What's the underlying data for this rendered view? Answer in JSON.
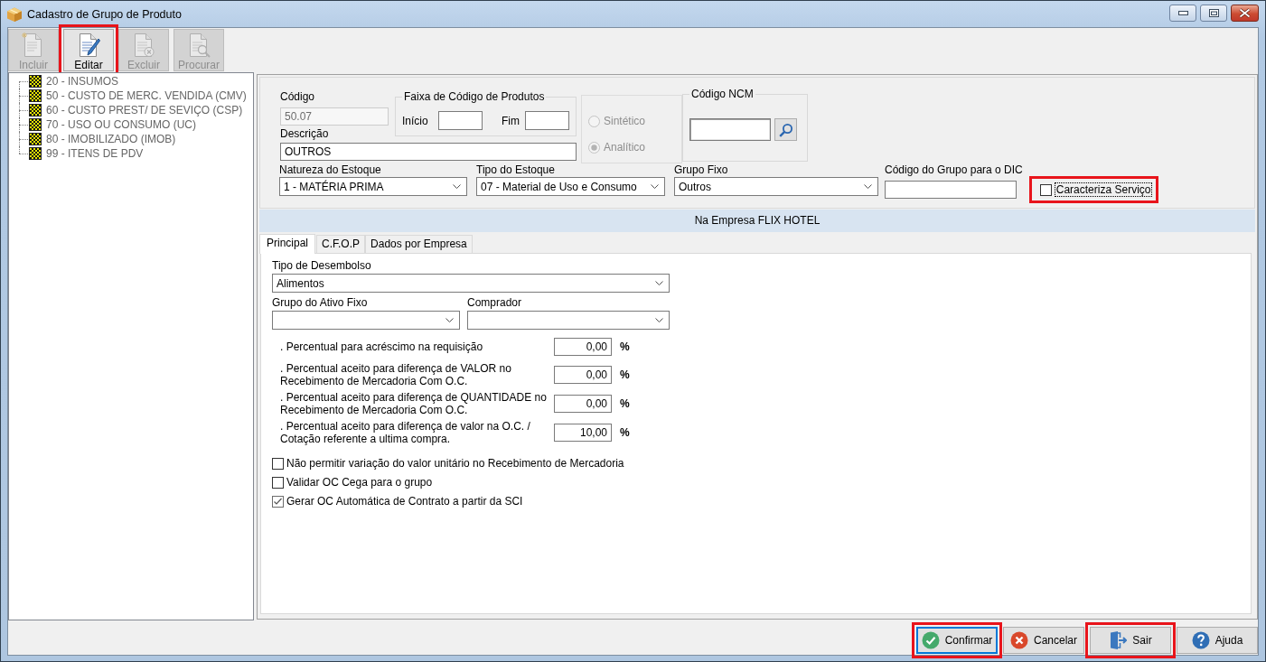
{
  "window": {
    "title": "Cadastro de Grupo de Produto"
  },
  "toolbar": [
    {
      "label": "Incluir",
      "kind": "new",
      "disabled": true,
      "highlighted": false
    },
    {
      "label": "Editar",
      "kind": "edit",
      "disabled": false,
      "highlighted": true
    },
    {
      "label": "Excluir",
      "kind": "delete",
      "disabled": true,
      "highlighted": false
    },
    {
      "label": "Procurar",
      "kind": "search",
      "disabled": true,
      "highlighted": false
    }
  ],
  "tree": {
    "items": [
      {
        "label": "20 - INSUMOS"
      },
      {
        "label": "50 - CUSTO DE MERC. VENDIDA (CMV)"
      },
      {
        "label": "60 - CUSTO PREST/ DE SEVIÇO (CSP)"
      },
      {
        "label": "70 - USO OU CONSUMO (UC)"
      },
      {
        "label": "80 - IMOBILIZADO (IMOB)"
      },
      {
        "label": "99 - ITENS DE PDV"
      }
    ]
  },
  "header": {
    "codigo": {
      "label": "Código",
      "value": "50.07",
      "disabled": true
    },
    "faixa": {
      "title": "Faixa de Código de Produtos",
      "inicio": {
        "label": "Início"
      },
      "fim": {
        "label": "Fim"
      }
    },
    "tipo": {
      "disabled": true,
      "options": [
        {
          "label": "Sintético",
          "selected": false
        },
        {
          "label": "Analítico",
          "selected": true
        }
      ]
    },
    "ncm": {
      "title": "Código NCM"
    },
    "descricao": {
      "label": "Descrição",
      "value": "OUTROS"
    },
    "selects": [
      {
        "label": "Natureza do Estoque",
        "value": "1 - MATÉRIA PRIMA"
      },
      {
        "label": "Tipo do Estoque",
        "value": "07 - Material de Uso e Consumo"
      },
      {
        "label": "Grupo Fixo",
        "value": "Outros"
      }
    ],
    "dic": {
      "label": "Código do Grupo para o DIC"
    },
    "caracteriza_servico": {
      "label": "Caracteriza Serviço",
      "checked": false,
      "focused": true,
      "highlighted": true
    }
  },
  "company_band": {
    "text": "Na Empresa FLIX HOTEL"
  },
  "tabs": [
    {
      "label": "Principal",
      "selected": true
    },
    {
      "label": "C.F.O.P",
      "selected": false
    },
    {
      "label": "Dados por Empresa",
      "selected": false
    }
  ],
  "principal": {
    "tipo_desembolso": {
      "label": "Tipo de Desembolso",
      "value": "Alimentos"
    },
    "grupo_ativo_fixo": {
      "label": "Grupo do Ativo Fixo"
    },
    "comprador": {
      "label": "Comprador"
    },
    "percentuais": [
      {
        "label": ". Percentual para acréscimo na requisição",
        "value": "0,00",
        "unit": "%"
      },
      {
        "label": ". Percentual aceito para diferença de VALOR no\nRecebimento de Mercadoria Com O.C.",
        "value": "0,00",
        "unit": "%"
      },
      {
        "label": ". Percentual aceito para diferença de QUANTIDADE no\nRecebimento de Mercadoria Com O.C.",
        "value": "0,00",
        "unit": "%"
      },
      {
        "label": ". Percentual aceito para diferença de valor na O.C. /\nCotação referente a ultima compra.",
        "value": "10,00",
        "unit": "%"
      }
    ],
    "checkboxes": [
      {
        "label": "Não permitir variação do valor unitário no Recebimento de Mercadoria",
        "checked": false
      },
      {
        "label": "Validar OC Cega para o grupo",
        "checked": false
      },
      {
        "label": "Gerar OC Automática de Contrato a partir da SCI",
        "checked": true
      }
    ]
  },
  "buttons": [
    {
      "label": "Confirmar",
      "kind": "confirm",
      "focused": true,
      "highlighted": true
    },
    {
      "label": "Cancelar",
      "kind": "cancel",
      "focused": false,
      "highlighted": false
    },
    {
      "label": "Sair",
      "kind": "exit",
      "focused": false,
      "highlighted": true
    },
    {
      "label": "Ajuda",
      "kind": "help",
      "focused": false,
      "highlighted": false
    }
  ]
}
